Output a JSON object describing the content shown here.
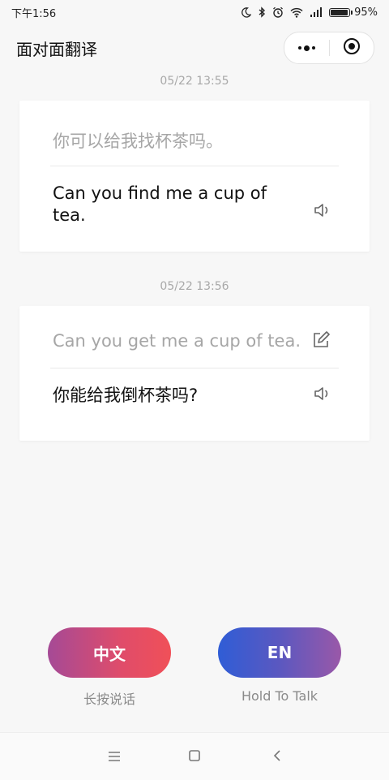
{
  "status": {
    "time": "下午1:56",
    "battery": "95%",
    "battery_level": 0.95
  },
  "header": {
    "title": "面对面翻译"
  },
  "conversations": [
    {
      "timestamp": "05/22 13:55",
      "source": "你可以给我找杯茶吗。",
      "target": "Can you find me a cup of tea."
    },
    {
      "timestamp": "05/22 13:56",
      "source": "Can you get me a cup of tea.",
      "target": "你能给我倒杯茶吗?"
    }
  ],
  "talk": {
    "zh_label": "中文",
    "zh_hint": "长按说话",
    "en_label": "EN",
    "en_hint": "Hold To Talk"
  },
  "icons": {
    "more": "more-dots-icon",
    "close_miniprogram": "target-circle-icon",
    "speaker": "speaker-icon",
    "edit": "edit-icon",
    "nav_menu": "menu-icon",
    "nav_home": "home-square-icon",
    "nav_back": "back-chevron-icon"
  },
  "colors": {
    "zh_gradient_start": "#a54a96",
    "zh_gradient_end": "#f05058",
    "en_gradient_start": "#2f5dd6",
    "en_gradient_end": "#9a58a8",
    "muted_text": "#a6a6a6"
  }
}
